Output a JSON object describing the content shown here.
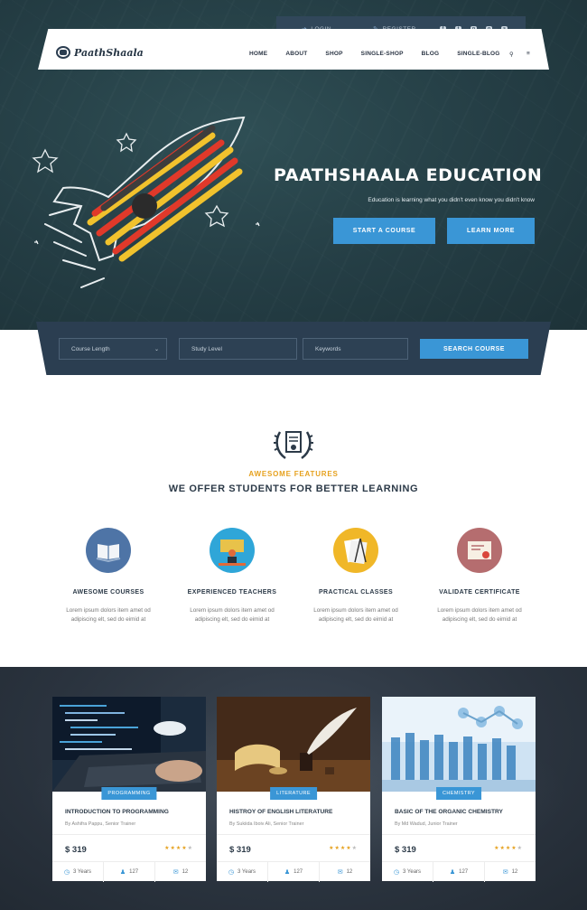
{
  "topbar": {
    "login": "LOGIN",
    "register": "REGISTER",
    "social_icons": [
      "facebook-icon",
      "twitter-icon",
      "pinterest-icon",
      "instagram-icon",
      "skype-icon"
    ]
  },
  "brand": {
    "name": "PaathShaala"
  },
  "nav": {
    "items": [
      "HOME",
      "ABOUT",
      "SHOP",
      "SINGLE-SHOP",
      "BLOG",
      "SINGLE-BLOG"
    ]
  },
  "hero": {
    "title": "PAATHSHAALA EDUCATION",
    "subtitle": "Education is learning what you didn't even know you didn't know",
    "btn_start": "START A COURSE",
    "btn_learn": "LEARN MORE"
  },
  "search": {
    "course_length": "Course Length",
    "study_level": "Study Level",
    "keywords": "Keywords",
    "button": "SEARCH COURSE"
  },
  "features": {
    "kicker": "AWESOME FEATURES",
    "title": "WE OFFER STUDENTS FOR BETTER LEARNING",
    "items": [
      {
        "title": "AWESOME COURSES",
        "text1": "Lorem ipsum dolors item amet od",
        "text2": "adipiscing elt, sed do eimid at",
        "icon": "book-icon",
        "color": "#4e74a6"
      },
      {
        "title": "EXPERIENCED TEACHERS",
        "text1": "Lorem ipsum dolors item amet od",
        "text2": "adipiscing elt, sed do eimid at",
        "icon": "teacher-icon",
        "color": "#2fa6d8"
      },
      {
        "title": "PRACTICAL CLASSES",
        "text1": "Lorem ipsum dolors item amet od",
        "text2": "adipiscing elt, sed do eimid at",
        "icon": "drafting-icon",
        "color": "#f0b728"
      },
      {
        "title": "VALIDATE CERTIFICATE",
        "text1": "Lorem ipsum dolors item amet od",
        "text2": "adipiscing elt, sed do eimid at",
        "icon": "certificate-icon",
        "color": "#b56d6f"
      }
    ]
  },
  "courses": [
    {
      "tag": "PROGRAMMING",
      "title": "INTRODUCTION TO PROGRAMMING",
      "by": "By Ashifra Pappu, Senior Trainer",
      "price": "$ 319",
      "rating": 4,
      "years": "3 Years",
      "students": "127",
      "comments": "12"
    },
    {
      "tag": "LITERATURE",
      "title": "HISTROY OF ENGLISH LITERATURE",
      "by": "By Sukiida Iboiv Ali, Senior Trainer",
      "price": "$ 319",
      "rating": 4,
      "years": "3 Years",
      "students": "127",
      "comments": "12"
    },
    {
      "tag": "CHEMISTRY",
      "title": "BASIC OF THE ORGANIC CHEMISTRY",
      "by": "By Md Wadud, Junior Trainer",
      "price": "$ 319",
      "rating": 4,
      "years": "3 Years",
      "students": "127",
      "comments": "12"
    }
  ],
  "colors": {
    "accent": "#3a96d6",
    "gold": "#e6a11e",
    "dark": "#2c3a48",
    "hero": "#243d44"
  }
}
